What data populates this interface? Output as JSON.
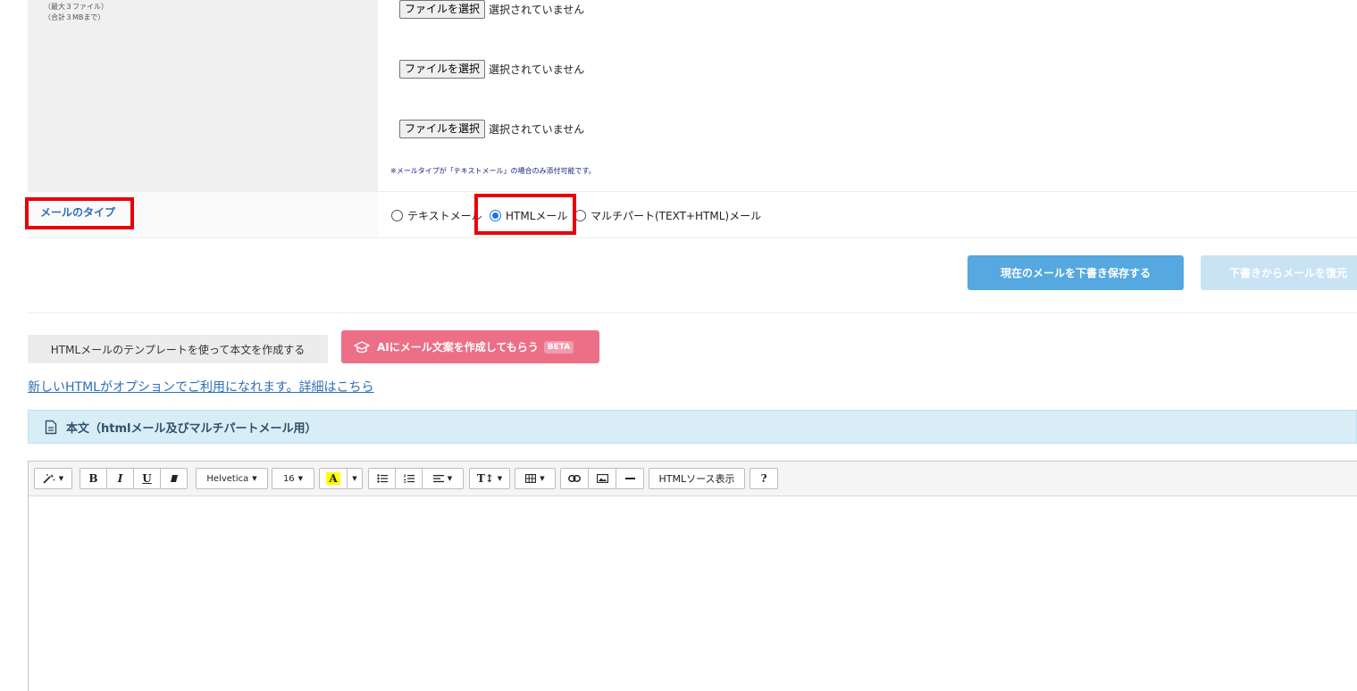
{
  "attachment": {
    "notes": [
      "（最大３ファイル）",
      "（合計３MBまで）"
    ],
    "files": [
      {
        "button_label": "ファイルを選択",
        "status": "選択されていません"
      },
      {
        "button_label": "ファイルを選択",
        "status": "選択されていません"
      },
      {
        "button_label": "ファイルを選択",
        "status": "選択されていません"
      }
    ],
    "footnote": "※メールタイプが「テキストメール」の場合のみ添付可能です。"
  },
  "mail_type": {
    "label": "メールのタイプ",
    "options": [
      {
        "label": "テキストメール",
        "selected": false
      },
      {
        "label": "HTMLメール",
        "selected": true
      },
      {
        "label": "マルチパート(TEXT+HTML)メール",
        "selected": false
      }
    ]
  },
  "draft": {
    "save_label": "現在のメールを下書き保存する",
    "restore_label": "下書きからメールを復元"
  },
  "template_button_label": "HTMLメールのテンプレートを使って本文を作成する",
  "ai_button": {
    "label": "AIにメール文案を作成してもらう",
    "badge": "BETA"
  },
  "option_link": "新しいHTMLがオプションでご利用になれます。詳細はこちら",
  "body_heading": "本文（htmlメール及びマルチパートメール用）",
  "toolbar": {
    "bold": "B",
    "italic": "I",
    "underline": "U",
    "font_name": "Helvetica",
    "font_size": "16",
    "highlight": "A",
    "text_size": "T↕",
    "source_label": "HTMLソース表示",
    "help": "?"
  },
  "colors": {
    "highlight_red": "#e8000b",
    "primary_blue": "#55a8e0",
    "ai_pink": "#ec6f87",
    "link_blue": "#2a6fb5"
  }
}
